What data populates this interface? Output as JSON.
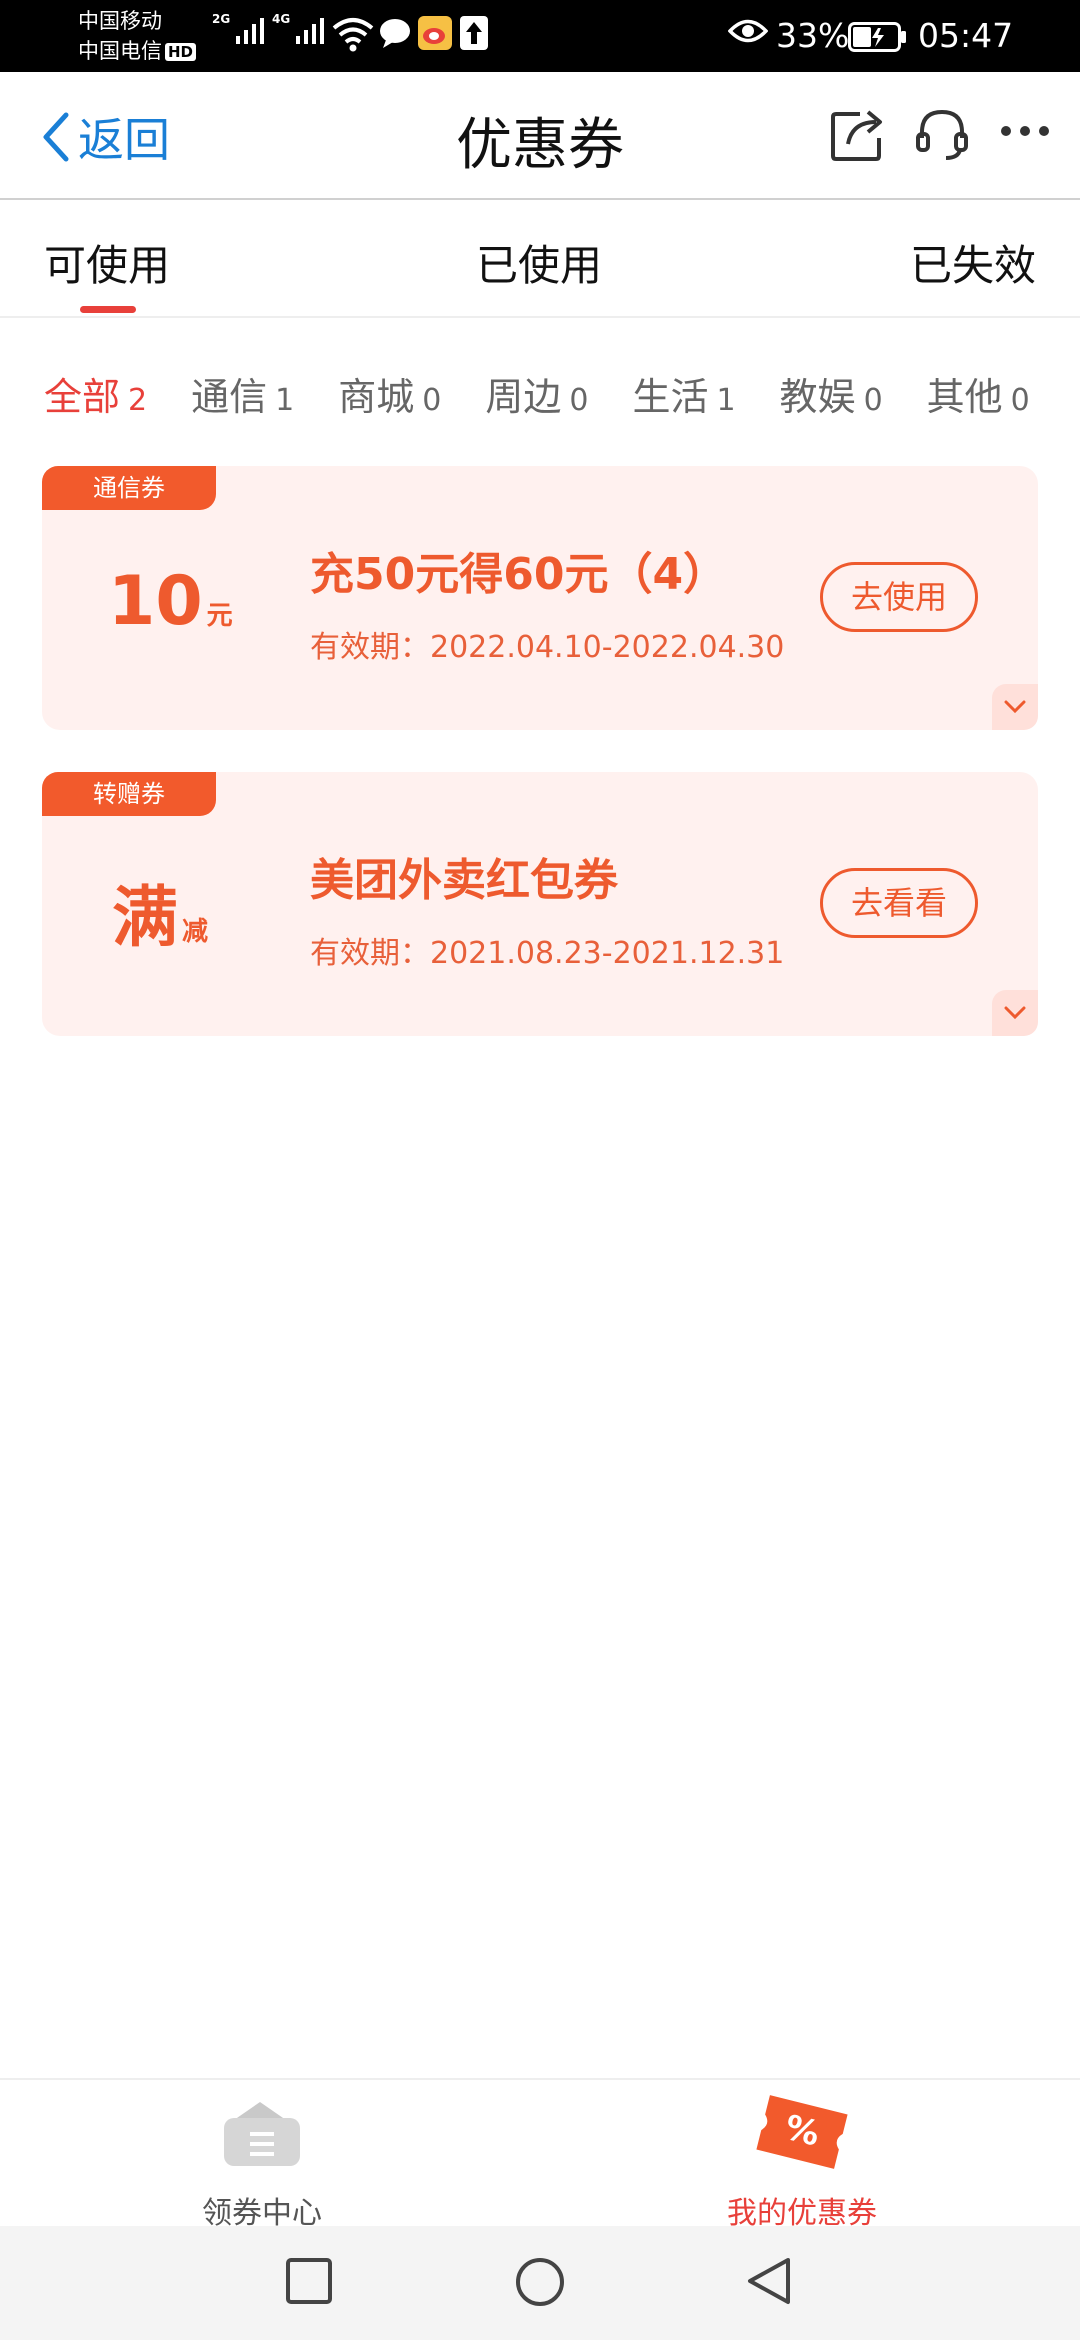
{
  "status_bar": {
    "carrier1": "中国移动",
    "carrier2": "中国电信",
    "hd": "HD",
    "net1": "2G",
    "net2": "4G",
    "battery": "33%",
    "time": "05:47"
  },
  "header": {
    "back_label": "返回",
    "title": "优惠券"
  },
  "tabs": [
    {
      "label": "可使用",
      "active": true
    },
    {
      "label": "已使用",
      "active": false
    },
    {
      "label": "已失效",
      "active": false
    }
  ],
  "filters": [
    {
      "label": "全部",
      "count": "2",
      "active": true
    },
    {
      "label": "通信",
      "count": "1"
    },
    {
      "label": "商城",
      "count": "0"
    },
    {
      "label": "周边",
      "count": "0"
    },
    {
      "label": "生活",
      "count": "1"
    },
    {
      "label": "教娱",
      "count": "0"
    },
    {
      "label": "其他",
      "count": "0"
    }
  ],
  "coupons": [
    {
      "tag": "通信券",
      "amount": "10",
      "unit": "元",
      "title": "充50元得60元（4）",
      "validity": "有效期：2022.04.10-2022.04.30",
      "button": "去使用"
    },
    {
      "tag": "转赠券",
      "amount": "满",
      "unit": "减",
      "title": "美团外卖红包券",
      "validity": "有效期：2021.08.23-2021.12.31",
      "button": "去看看"
    }
  ],
  "bottom_nav": [
    {
      "label": "领券中心",
      "icon": "coupon-center-icon",
      "active": false
    },
    {
      "label": "我的优惠券",
      "icon": "my-coupon-icon",
      "active": true
    }
  ],
  "colors": {
    "accent": "#e8403a",
    "coupon_orange": "#ee5a2e",
    "coupon_bg": "#fff1ef",
    "link_blue": "#1a7fd6"
  }
}
